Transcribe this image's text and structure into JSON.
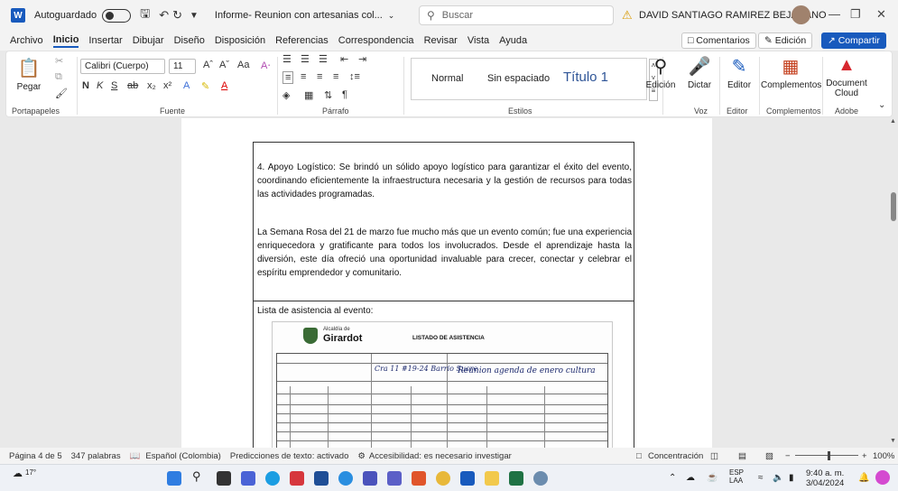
{
  "titlebar": {
    "autosave_label": "Autoguardado",
    "doc_title": "Informe- Reunion con artesanias col...",
    "search_placeholder": "Buscar",
    "user_name": "DAVID SANTIAGO RAMIREZ BEJARANO",
    "icons": [
      "word-logo-icon",
      "save-icon",
      "undo-icon",
      "redo-icon",
      "customize-icon",
      "warning-icon",
      "minimize-icon",
      "restore-icon",
      "close-icon"
    ]
  },
  "menu": {
    "items": [
      "Archivo",
      "Inicio",
      "Insertar",
      "Dibujar",
      "Diseño",
      "Disposición",
      "Referencias",
      "Correspondencia",
      "Revisar",
      "Vista",
      "Ayuda"
    ],
    "active": "Inicio",
    "comments": "Comentarios",
    "editing": "Edición",
    "share": "Compartir"
  },
  "ribbon": {
    "paste": "Pegar",
    "font_name": "Calibri (Cuerpo)",
    "font_size": "11",
    "styles": [
      "Normal",
      "Sin espaciado",
      "Título 1"
    ],
    "dictate": "Dictar",
    "editing": "Edición",
    "editor": "Editor",
    "addins": "Complementos",
    "doc_cloud": "Document Cloud",
    "groups": [
      "Portapapeles",
      "Fuente",
      "Párrafo",
      "Estilos",
      "Voz",
      "Editor",
      "Complementos",
      "Adobe"
    ]
  },
  "document": {
    "para1": "4. Apoyo Logístico: Se brindó un sólido apoyo logístico para garantizar el éxito del evento, coordinando eficientemente la infraestructura necesaria y la gestión de recursos para todas las actividades programadas.",
    "para2": "La Semana Rosa del 21 de marzo fue mucho más que un evento común; fue una experiencia enriquecedora y gratificante para todos los involucrados. Desde el aprendizaje hasta la diversión, este día ofreció una oportunidad invaluable para crecer, conectar y celebrar el espíritu emprendedor y comunitario.",
    "attendance_heading": "Lista de asistencia al evento:",
    "scan": {
      "org_small": "Alcaldía de",
      "org": "Girardot",
      "title": "LISTADO DE ASISTENCIA",
      "hand_location": "Cra 11 #19-24 Barrio Sucre",
      "hand_meeting": "Reunion agenda de enero cultura"
    }
  },
  "status": {
    "page": "Página 4 de 5",
    "words": "347 palabras",
    "language": "Español (Colombia)",
    "predictions": "Predicciones de texto: activado",
    "accessibility": "Accesibilidad: es necesario investigar",
    "focus": "Concentración",
    "zoom": "100%"
  },
  "taskbar": {
    "weather": "17°",
    "lang1": "ESP",
    "lang2": "LAA",
    "time": "9:40 a. m.",
    "date": "3/04/2024"
  }
}
